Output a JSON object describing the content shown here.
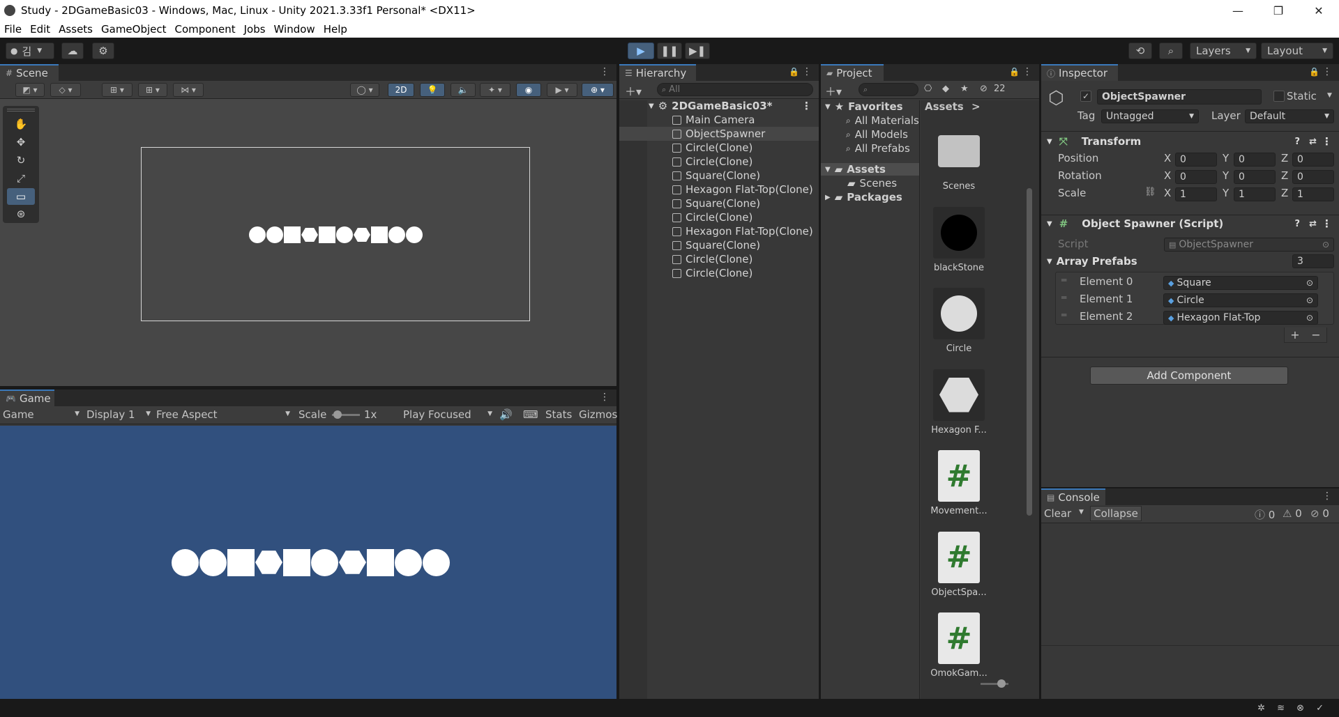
{
  "titlebar": {
    "title": "Study - 2DGameBasic03 - Windows, Mac, Linux - Unity 2021.3.33f1 Personal* <DX11>",
    "minimize": "—",
    "maximize": "❐",
    "close": "✕"
  },
  "menu": [
    "File",
    "Edit",
    "Assets",
    "GameObject",
    "Component",
    "Jobs",
    "Window",
    "Help"
  ],
  "toolbar": {
    "account": "김",
    "layers": "Layers",
    "layout": "Layout"
  },
  "scene": {
    "tab": "Scene",
    "mode_2d": "2D"
  },
  "game": {
    "tab": "Game",
    "view_select": "Game",
    "display": "Display 1",
    "aspect": "Free Aspect",
    "scale_label": "Scale",
    "scale_value": "1x",
    "play_mode": "Play Focused",
    "stats": "Stats",
    "gizmos": "Gizmos",
    "background": "#31507e",
    "shape_sequence": [
      "circle",
      "circle",
      "square",
      "hexagon",
      "square",
      "circle",
      "hexagon",
      "square",
      "circle",
      "circle"
    ]
  },
  "hierarchy": {
    "tab": "Hierarchy",
    "search_placeholder": "All",
    "scene_name": "2DGameBasic03*",
    "items": [
      "Main Camera",
      "ObjectSpawner",
      "Circle(Clone)",
      "Circle(Clone)",
      "Square(Clone)",
      "Hexagon Flat-Top(Clone)",
      "Square(Clone)",
      "Circle(Clone)",
      "Hexagon Flat-Top(Clone)",
      "Square(Clone)",
      "Circle(Clone)",
      "Circle(Clone)"
    ],
    "selected": "ObjectSpawner"
  },
  "project": {
    "tab": "Project",
    "hidden_count": "22",
    "favorites_label": "Favorites",
    "favorites": [
      "All Materials",
      "All Models",
      "All Prefabs"
    ],
    "assets_label": "Assets",
    "assets_children": [
      "Scenes"
    ],
    "packages_label": "Packages",
    "breadcrumb": "Assets",
    "breadcrumb_arrow": ">",
    "items": [
      {
        "name": "Scenes",
        "kind": "folder"
      },
      {
        "name": "blackStone",
        "kind": "black-circle"
      },
      {
        "name": "Circle",
        "kind": "circle"
      },
      {
        "name": "Hexagon F...",
        "kind": "hexagon"
      },
      {
        "name": "Movement...",
        "kind": "script"
      },
      {
        "name": "ObjectSpa...",
        "kind": "script"
      },
      {
        "name": "OmokGam...",
        "kind": "script"
      }
    ]
  },
  "inspector": {
    "tab": "Inspector",
    "object_name": "ObjectSpawner",
    "static_label": "Static",
    "tag_label": "Tag",
    "tag_value": "Untagged",
    "layer_label": "Layer",
    "layer_value": "Default",
    "transform": {
      "title": "Transform",
      "position_label": "Position",
      "rotation_label": "Rotation",
      "scale_label": "Scale",
      "x": "X",
      "y": "Y",
      "z": "Z",
      "position": [
        "0",
        "0",
        "0"
      ],
      "rotation": [
        "0",
        "0",
        "0"
      ],
      "scale": [
        "1",
        "1",
        "1"
      ]
    },
    "script_component": {
      "title": "Object Spawner (Script)",
      "script_label": "Script",
      "script_value": "ObjectSpawner",
      "array_label": "Array Prefabs",
      "array_size": "3",
      "elements": [
        {
          "label": "Element 0",
          "value": "Square"
        },
        {
          "label": "Element 1",
          "value": "Circle"
        },
        {
          "label": "Element 2",
          "value": "Hexagon Flat-Top"
        }
      ]
    },
    "add_component": "Add Component"
  },
  "console": {
    "tab": "Console",
    "clear": "Clear",
    "collapse": "Collapse",
    "log_count": "0",
    "warn_count": "0",
    "error_count": "0"
  }
}
